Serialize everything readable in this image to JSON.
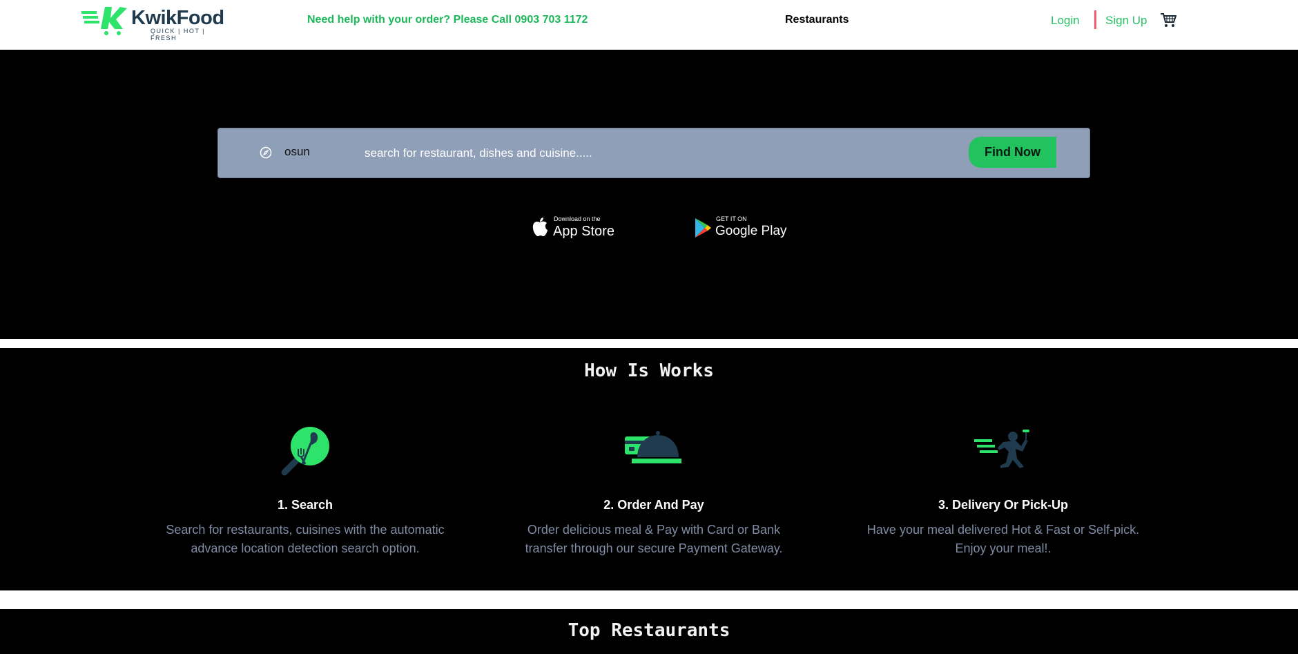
{
  "header": {
    "brand_name": "KwikFood",
    "brand_tagline": "QUICK | HOT | FRESH",
    "help_text": "Need help with your order? Please Call 0903 703 1172",
    "nav_restaurants": "Restaurants",
    "login_label": "Login",
    "signup_label": "Sign Up",
    "cart_icon": "cart-icon"
  },
  "hero": {
    "location_value": "osun",
    "search_placeholder": "search for restaurant, dishes and cuisine.....",
    "find_button": "Find Now",
    "app_store": {
      "small": "Download on the",
      "big": "App Store"
    },
    "google_play": {
      "small": "GET IT ON",
      "big": "Google Play"
    }
  },
  "how_it_works": {
    "title": "How Is Works",
    "steps": [
      {
        "icon": "search-fork-spoon-icon",
        "title": "1. Search",
        "desc_line1": "Search for restaurants, cuisines with the automatic",
        "desc_line2": "advance location detection search option."
      },
      {
        "icon": "card-cloche-icon",
        "title": "2. Order And Pay",
        "desc_line1": "Order delicious meal & Pay with Card or Bank",
        "desc_line2": "transfer through our secure Payment Gateway."
      },
      {
        "icon": "delivery-runner-icon",
        "title": "3. Delivery Or Pick-Up",
        "desc_line1": "Have your meal delivered Hot & Fast or Self-pick.",
        "desc_line2": "Enjoy your meal!."
      }
    ]
  },
  "top_restaurants": {
    "title": "Top Restaurants"
  },
  "colors": {
    "brand_green": "#22c35e",
    "brand_dark": "#1f3b4d",
    "search_bar": "#8f9fb7",
    "separator_red": "#f05a6a",
    "muted_text": "#7f8ca3"
  }
}
